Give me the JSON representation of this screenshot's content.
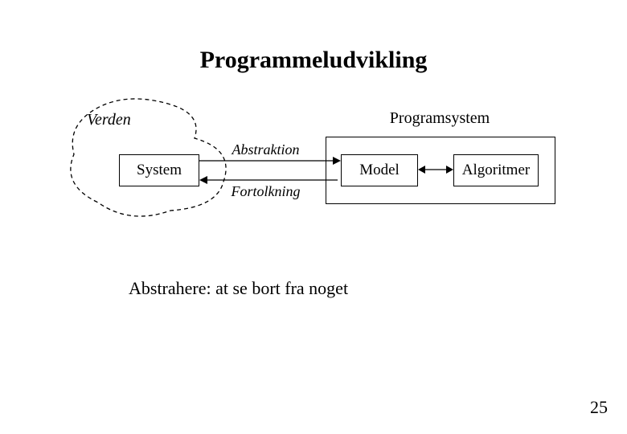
{
  "title": "Programmeludvikling",
  "verden_label": "Verden",
  "programsystem_label": "Programsystem",
  "system_label": "System",
  "model_label": "Model",
  "algoritmer_label": "Algoritmer",
  "abstraktion_label": "Abstraktion",
  "fortolkning_label": "Fortolkning",
  "caption": "Abstrahere: at se bort fra noget",
  "page_number": "25"
}
